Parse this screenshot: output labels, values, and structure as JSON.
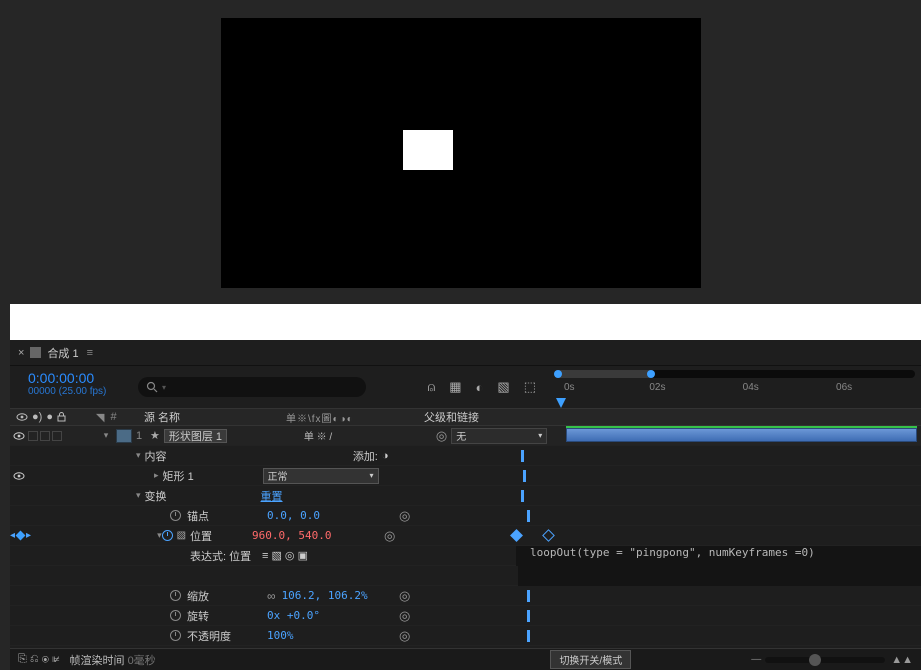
{
  "viewer": {
    "shape_label": "white rectangle"
  },
  "tab": {
    "close": "×",
    "name": "合成 1",
    "menu": "≡"
  },
  "header": {
    "timecode": "0:00:00:00",
    "frameinfo": "00000 (25.00 fps)",
    "search_placeholder": "",
    "icons": {
      "shy": "⍝",
      "frame_blend": "▦",
      "motion_blur": "◐",
      "graph": "▧",
      "snap": "⬚"
    }
  },
  "ruler": {
    "t0": "0s",
    "t1": "02s",
    "t2": "04s",
    "t3": "06s"
  },
  "columns": {
    "av": {
      "eye": "●",
      "speaker": "●",
      "solo": "●",
      "lock": "●"
    },
    "tag": "●",
    "num": "#",
    "source": "源 名称",
    "switches": "单※\\fx圖◐◑◐",
    "parent": "父级和链接"
  },
  "layer": {
    "index": "1",
    "name": "形状图层 1",
    "sw_glyphs": "单 ※ /",
    "parent_label": "无",
    "contents_label": "内容",
    "add_label": "添加:",
    "rect_label": "矩形 1",
    "rect_mode": "正常",
    "transform_label": "变换",
    "transform_reset": "重置",
    "anchor": {
      "label": "锚点",
      "value": "0.0, 0.0"
    },
    "position": {
      "label": "位置",
      "value": "960.0, 540.0"
    },
    "position_expr_label": "表达式: 位置",
    "expr_icons": "≡  ▧  ◎  ▣",
    "expression": "loopOut(type = \"pingpong\", numKeyframes =0)",
    "scale": {
      "label": "缩放",
      "value": "106.2, 106.2%"
    },
    "rotation": {
      "label": "旋转",
      "value": "0x +0.0°"
    },
    "opacity": {
      "label": "不透明度",
      "value": "100%"
    }
  },
  "footer": {
    "icons": "⎘  ⎌  ⦿  ⊯",
    "render_label": "帧渲染时间",
    "render_value": "0毫秒",
    "toggle": "切换开关/模式"
  }
}
